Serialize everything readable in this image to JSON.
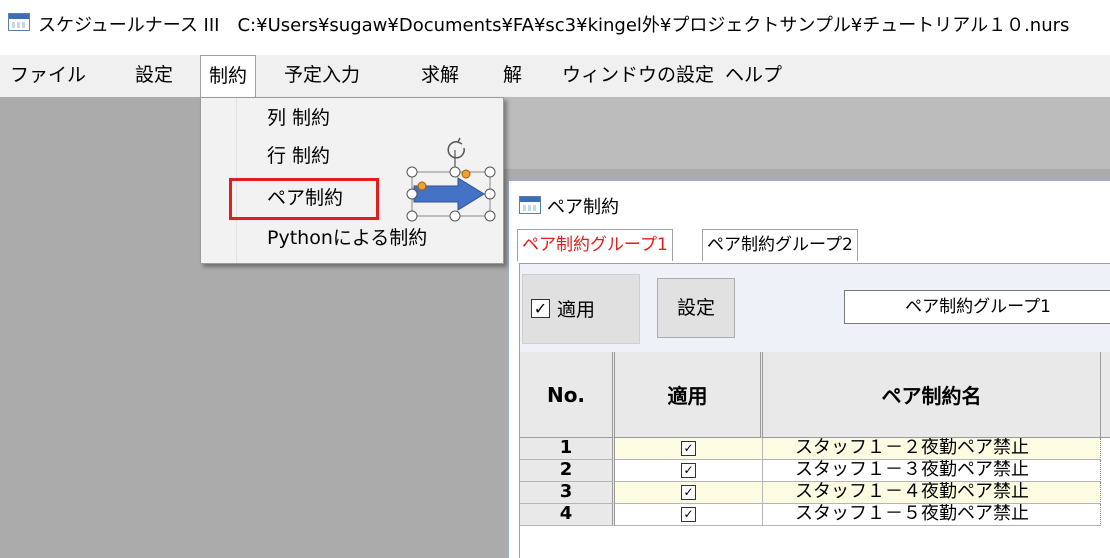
{
  "window": {
    "title": "スケジュールナース III　C:¥Users¥sugaw¥Documents¥FA¥sc3¥kingel外¥プロジェクトサンプル¥チュートリアル１０.nurs"
  },
  "menu": {
    "items": [
      "ファイル",
      "設定",
      "制約",
      "予定入力",
      "求解",
      "解",
      "ウィンドウの設定",
      "ヘルプ"
    ],
    "active_index": 2
  },
  "dropdown": {
    "items": [
      "列 制約",
      "行 制約",
      "ペア制約",
      "Pythonによる制約"
    ],
    "highlighted": "ペア制約"
  },
  "colors": {
    "highlight_border": "#e21d1d",
    "arrow_fill": "#4472c4",
    "handle_orange": "#f0a030",
    "row_alt": "#fdfbe1"
  },
  "pair_window": {
    "title": "ペア制約",
    "tabs": [
      {
        "label": "ペア制約グループ1",
        "selected": true
      },
      {
        "label": "ペア制約グループ2",
        "selected": false
      }
    ],
    "apply_label": "適用",
    "apply_checked": true,
    "settings_label": "設定",
    "group_name": "ペア制約グループ1",
    "grid": {
      "headers": [
        "No.",
        "適用",
        "ペア制約名"
      ],
      "rows": [
        {
          "no": "1",
          "checked": true,
          "name": "スタッフ１－２夜勤ペア禁止"
        },
        {
          "no": "2",
          "checked": true,
          "name": "スタッフ１－３夜勤ペア禁止"
        },
        {
          "no": "3",
          "checked": true,
          "name": "スタッフ１－４夜勤ペア禁止"
        },
        {
          "no": "4",
          "checked": true,
          "name": "スタッフ１－５夜勤ペア禁止"
        }
      ]
    }
  }
}
